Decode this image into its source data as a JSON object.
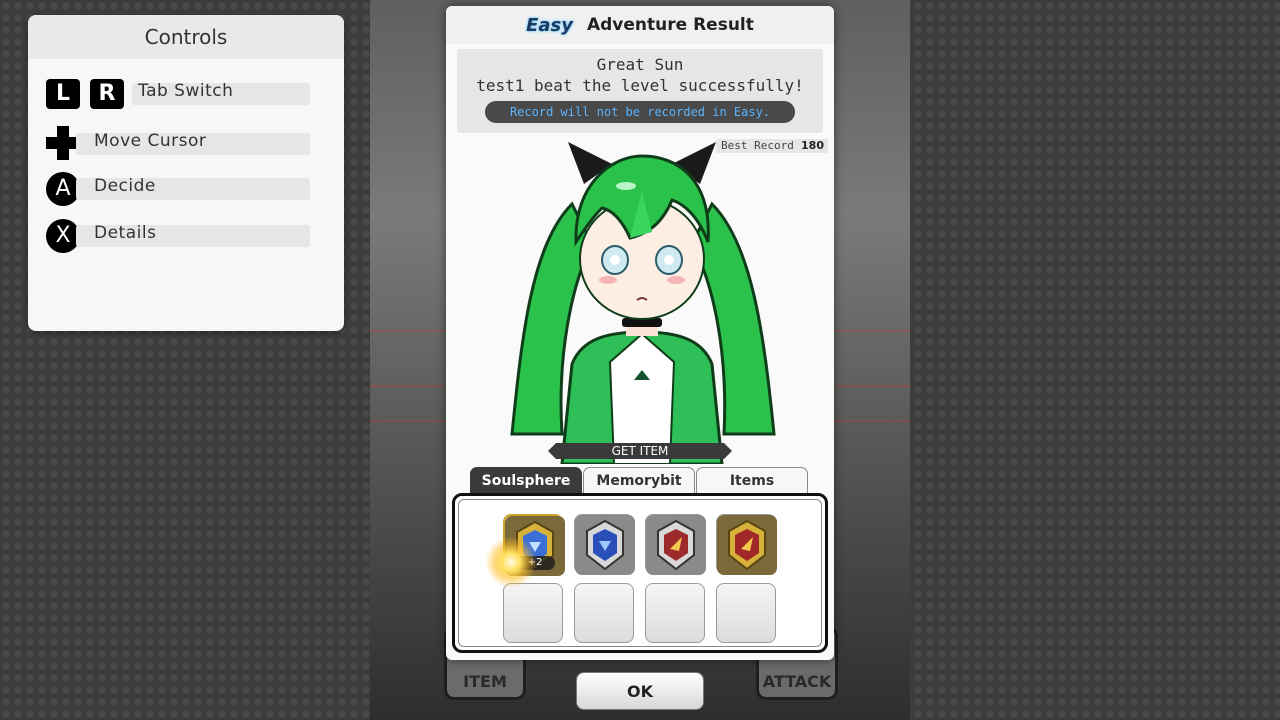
{
  "controls": {
    "title": "Controls",
    "items": [
      {
        "keys": [
          "L",
          "R"
        ],
        "label": "Tab Switch"
      },
      {
        "key": "dpad",
        "label": "Move Cursor"
      },
      {
        "key": "A",
        "label": "Decide"
      },
      {
        "key": "X",
        "label": "Details"
      }
    ]
  },
  "dialog": {
    "difficulty": "Easy",
    "title": "Adventure Result",
    "stage_name": "Great Sun",
    "result_message": "test1 beat the level successfully!",
    "record_note": "Record will not be recorded in Easy.",
    "best_record_label": "Best Record",
    "best_record_value": "180",
    "get_item_banner": "GET ITEM",
    "tabs": [
      {
        "label": "Soulsphere",
        "active": true
      },
      {
        "label": "Memorybit",
        "active": false
      },
      {
        "label": "Items",
        "active": false
      }
    ],
    "items": [
      {
        "icon": "gold-blue-soulsphere-icon",
        "quantity": "+2",
        "highlighted": true
      },
      {
        "icon": "silver-blue-soulsphere-icon"
      },
      {
        "icon": "silver-red-soulsphere-icon"
      },
      {
        "icon": "gold-red-soulsphere-icon"
      }
    ],
    "empty_slots": 4,
    "ok_label": "OK"
  },
  "background": {
    "left_button": "ITEM",
    "right_button": "ATTACK"
  },
  "colors": {
    "hair": "#2bc24c",
    "accent_blue": "#5ab4ff",
    "active_tab": "#3b3b3b"
  }
}
